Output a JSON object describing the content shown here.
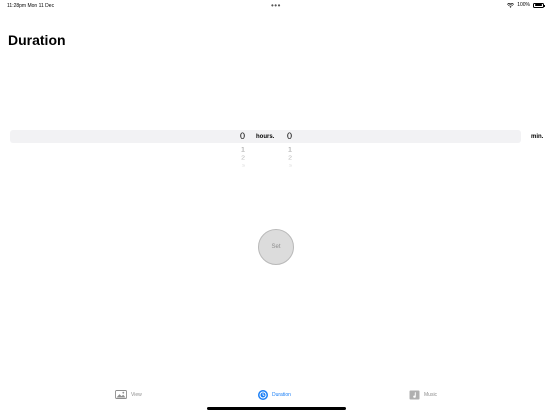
{
  "status_bar": {
    "time_date": "11:28pm   Mon 11 Dec",
    "dots": "•••",
    "battery": "100%"
  },
  "header": {
    "title": "Duration"
  },
  "picker": {
    "hours_values": [
      "0",
      "1",
      "2",
      "3"
    ],
    "hours_unit": "hours.",
    "minutes_values": [
      "0",
      "1",
      "2",
      "3"
    ],
    "minutes_unit": "min."
  },
  "actions": {
    "set_label": "Set"
  },
  "tabs": [
    {
      "label": "View",
      "icon": "photo-icon",
      "selected": false
    },
    {
      "label": "Duration",
      "icon": "timer-icon",
      "selected": true
    },
    {
      "label": "Music",
      "icon": "music-note-icon",
      "selected": false
    }
  ],
  "colors": {
    "accent": "#1a7ff6",
    "picker_band": "#f2f2f4",
    "inactive": "#8e8e8e"
  }
}
